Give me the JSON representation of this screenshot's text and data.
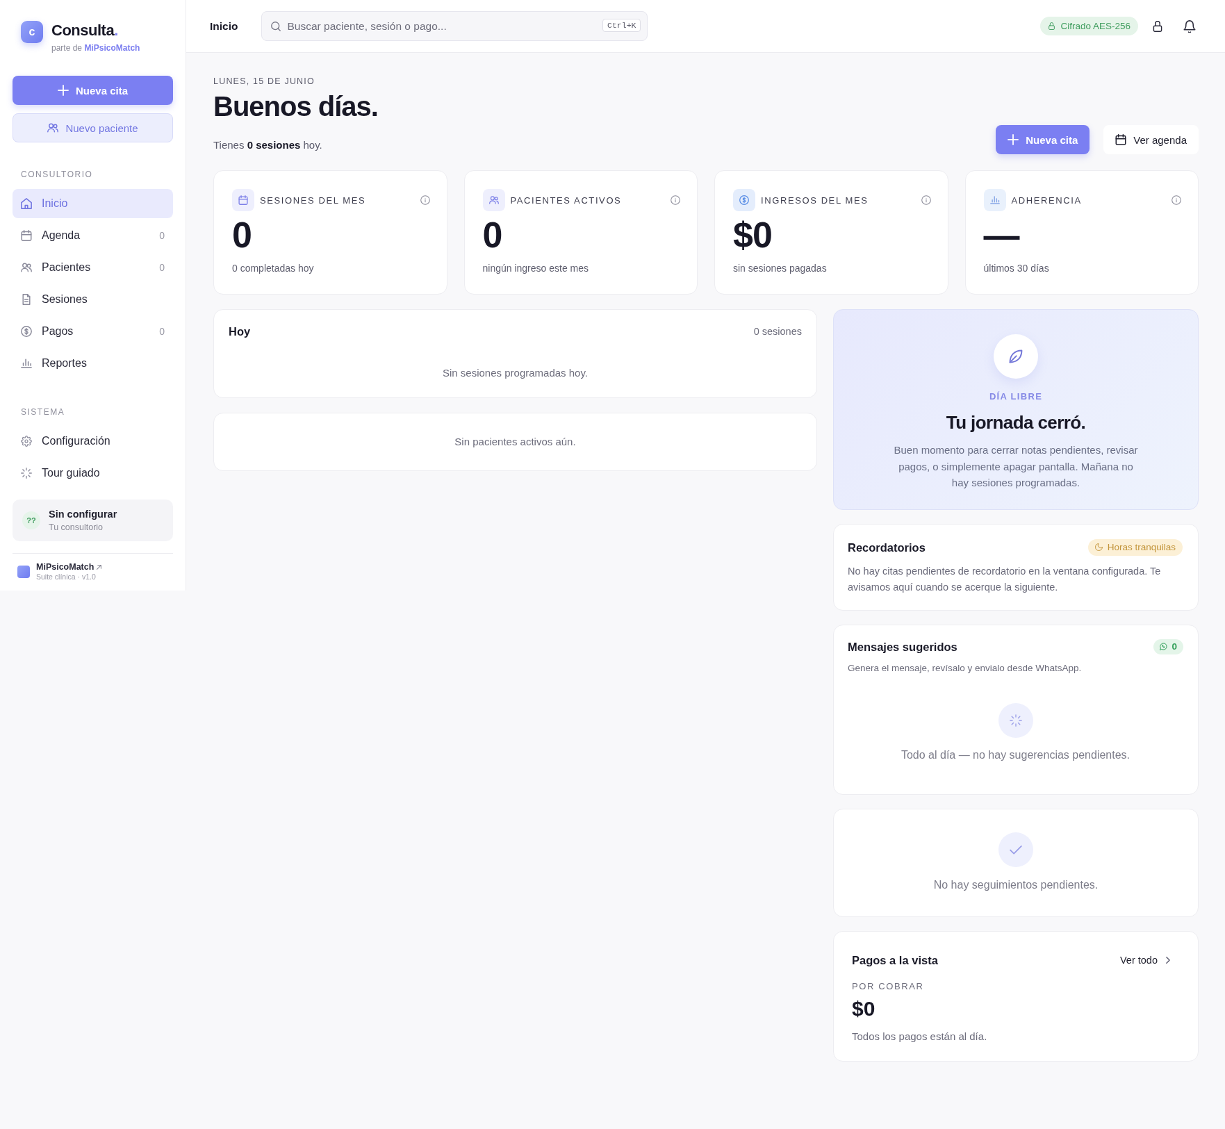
{
  "sidebar": {
    "brand": {
      "initial": "c",
      "name": "Consulta",
      "dot": ".",
      "tagline": "parte de **MiPsicoMatch**"
    },
    "actions": [
      {
        "label": "Nueva cita",
        "kind": "primary"
      },
      {
        "label": "Nuevo paciente",
        "kind": "secondary"
      }
    ],
    "sections": [
      {
        "title": "CONSULTORIO",
        "items": [
          {
            "label": "Inicio",
            "selected": true
          },
          {
            "label": "Agenda",
            "count": "0",
            "selected": false
          },
          {
            "label": "Pacientes",
            "count": "0",
            "selected": false
          },
          {
            "label": "Sesiones",
            "selected": false
          },
          {
            "label": "Pagos",
            "count": "0",
            "selected": false
          },
          {
            "label": "Reportes",
            "selected": false
          }
        ]
      },
      {
        "title": "SISTEMA",
        "items": [
          {
            "label": "Configuración",
            "selected": false
          },
          {
            "label": "Tour guiado",
            "selected": false
          }
        ]
      }
    ],
    "setup_card": {
      "marker": "??",
      "title": "Sin configurar",
      "subtitle": "Tu consultorio"
    },
    "footer": {
      "name": "MiPsicoMatch",
      "subtitle": "Suite clínica · v1.0"
    }
  },
  "topbar": {
    "title": "Inicio",
    "search": {
      "placeholder": "Buscar paciente, sesión o pago...",
      "shortcut": "Ctrl+K"
    },
    "security_badge": "Cifrado AES-256"
  },
  "header": {
    "date": "LUNES, 15 DE JUNIO",
    "greeting": "Buenos días.",
    "summary": "Tienes **0 sesiones** hoy.",
    "actions": [
      {
        "label": "Nueva cita",
        "kind": "primary"
      },
      {
        "label": "Ver agenda",
        "kind": "outline"
      }
    ]
  },
  "stats": [
    {
      "label": "SESIONES DEL MES",
      "value": "0",
      "note": "0 completadas hoy"
    },
    {
      "label": "PACIENTES ACTIVOS",
      "value": "0",
      "note": "ningún ingreso este mes"
    },
    {
      "label": "INGRESOS DEL MES",
      "value": "$0",
      "note": "sin sesiones pagadas"
    },
    {
      "label": "ADHERENCIA",
      "value": "—",
      "note": "últimos 30 días"
    }
  ],
  "today": {
    "title": "Hoy",
    "count": "0 sesiones",
    "empty": "Sin sesiones programadas hoy."
  },
  "patients": {
    "empty": "Sin pacientes activos aún."
  },
  "day_off": {
    "eyebrow": "DÍA LIBRE",
    "title": "Tu jornada cerró.",
    "body": "Buen momento para cerrar notas pendientes, revisar pagos, o simplemente apagar pantalla. Mañana no hay sesiones programadas."
  },
  "reminders": {
    "title": "Recordatorios",
    "badge": "Horas tranquilas",
    "body": "No hay citas pendientes de recordatorio en la ventana configurada. Te avisamos aquí cuando se acerque la siguiente."
  },
  "messages": {
    "title": "Mensajes sugeridos",
    "count": "0",
    "subtitle": "Genera el mensaje, revísalo y envialo desde WhatsApp.",
    "empty": "Todo al día — no hay sugerencias pendientes."
  },
  "follow_ups": {
    "empty": "No hay seguimientos pendientes."
  },
  "payments": {
    "title": "Pagos a la vista",
    "link": "Ver todo",
    "label": "POR COBRAR",
    "amount": "$0",
    "note": "Todos los pagos están al día."
  }
}
